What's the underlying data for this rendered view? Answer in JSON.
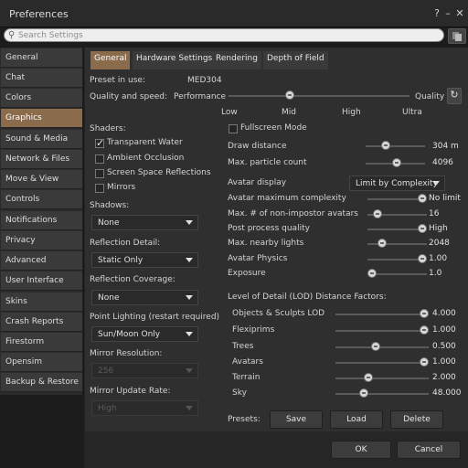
{
  "window": {
    "title": "Preferences",
    "help_glyph": "?",
    "min_glyph": "–",
    "close_glyph": "✕"
  },
  "search": {
    "placeholder": "Search Settings",
    "icon": "search-icon"
  },
  "sidebar": {
    "items": [
      {
        "label": "General"
      },
      {
        "label": "Chat"
      },
      {
        "label": "Colors"
      },
      {
        "label": "Graphics",
        "selected": true
      },
      {
        "label": "Sound & Media"
      },
      {
        "label": "Network & Files"
      },
      {
        "label": "Move & View"
      },
      {
        "label": "Controls"
      },
      {
        "label": "Notifications"
      },
      {
        "label": "Privacy"
      },
      {
        "label": "Advanced"
      },
      {
        "label": "User Interface"
      },
      {
        "label": "Skins"
      },
      {
        "label": "Crash Reports"
      },
      {
        "label": "Firestorm"
      },
      {
        "label": "Opensim"
      },
      {
        "label": "Backup & Restore"
      }
    ]
  },
  "tabs": [
    {
      "label": "General",
      "selected": true
    },
    {
      "label": "Hardware Settings"
    },
    {
      "label": "Rendering"
    },
    {
      "label": "Depth of Field"
    }
  ],
  "preset": {
    "label": "Preset in use:",
    "value": "MED304"
  },
  "quality": {
    "label": "Quality and speed:",
    "left": "Performance",
    "right": "Quality",
    "level": 0.33,
    "ticks": [
      "Low",
      "Mid",
      "High",
      "Ultra"
    ]
  },
  "fullscreen": {
    "label": "Fullscreen Mode",
    "checked": false
  },
  "shaders": {
    "title": "Shaders:",
    "items": [
      {
        "label": "Transparent Water",
        "checked": true
      },
      {
        "label": "Ambient Occlusion",
        "checked": false
      },
      {
        "label": "Screen Space Reflections",
        "checked": false
      },
      {
        "label": "Mirrors",
        "checked": false
      }
    ]
  },
  "left_dropdowns": [
    {
      "label": "Shadows:",
      "value": "None",
      "enabled": true
    },
    {
      "label": "Reflection Detail:",
      "value": "Static Only",
      "enabled": true
    },
    {
      "label": "Reflection Coverage:",
      "value": "None",
      "enabled": true
    },
    {
      "label": "Point Lighting (restart required)",
      "value": "Sun/Moon Only",
      "enabled": true
    },
    {
      "label": "Mirror Resolution:",
      "value": "256",
      "enabled": false
    },
    {
      "label": "Mirror Update Rate:",
      "value": "High",
      "enabled": false
    }
  ],
  "draw_distance": {
    "label": "Draw distance",
    "value": "304",
    "unit": "m",
    "level": 0.3
  },
  "particles": {
    "label": "Max. particle count",
    "value": "4096",
    "level": 0.52
  },
  "avatar_display": {
    "label": "Avatar display",
    "value": "Limit by Complexity"
  },
  "avatar_sliders": [
    {
      "label": "Avatar maximum complexity",
      "value": "No limit",
      "level": 1.0
    },
    {
      "label": "Max. # of non-impostor avatars",
      "value": "16",
      "level": 0.1
    },
    {
      "label": "Post process quality",
      "value": "High",
      "level": 1.0
    },
    {
      "label": "Max. nearby lights",
      "value": "2048",
      "level": 0.2
    },
    {
      "label": "Avatar Physics",
      "value": "1.00",
      "level": 1.0
    },
    {
      "label": "Exposure",
      "value": "1.0",
      "level": 0.0
    }
  ],
  "lod": {
    "title": "Level of Detail (LOD) Distance Factors:",
    "items": [
      {
        "label": "Objects & Sculpts LOD",
        "value": "4.000",
        "level": 1.0
      },
      {
        "label": "Flexiprims",
        "value": "1.000",
        "level": 1.0
      },
      {
        "label": "Trees",
        "value": "0.500",
        "level": 0.42
      },
      {
        "label": "Avatars",
        "value": "1.000",
        "level": 1.0
      },
      {
        "label": "Terrain",
        "value": "2.000",
        "level": 0.34
      },
      {
        "label": "Sky",
        "value": "48.000",
        "level": 0.28
      }
    ]
  },
  "presets": {
    "label": "Presets:",
    "save": "Save",
    "load": "Load",
    "delete": "Delete"
  },
  "footer": {
    "ok": "OK",
    "cancel": "Cancel"
  }
}
